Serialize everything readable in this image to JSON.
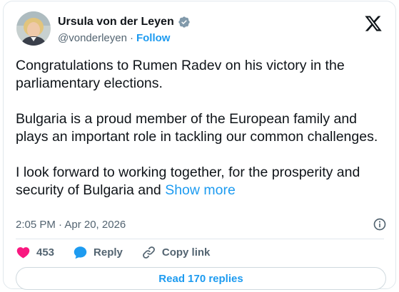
{
  "author": {
    "display_name": "Ursula von der Leyen",
    "handle": "@vonderleyen",
    "separator": "·",
    "follow_label": "Follow",
    "verified": true
  },
  "tweet": {
    "paragraphs": [
      "Congratulations to Rumen Radev on his victory in the parliamentary elections.",
      "Bulgaria is a proud member of the European family and plays an important role in tackling our common challenges.",
      "I look forward to working together, for the prosperity and security of Bulgaria and"
    ],
    "show_more_label": "Show more"
  },
  "meta": {
    "timestamp": "2:05 PM · Apr 20, 2026"
  },
  "actions": {
    "likes_count": "453",
    "reply_label": "Reply",
    "copy_link_label": "Copy link"
  },
  "replies_button_label": "Read 170 replies",
  "colors": {
    "accent": "#1d9bf0",
    "like": "#f91880",
    "text": "#0f1419",
    "secondary": "#536471",
    "verified_gray": "#829aab"
  },
  "icons": {
    "logo": "x-logo-icon",
    "verified": "verified-badge-icon",
    "info": "info-icon",
    "like": "heart-icon",
    "reply": "speech-bubble-icon",
    "copy_link": "link-icon"
  }
}
